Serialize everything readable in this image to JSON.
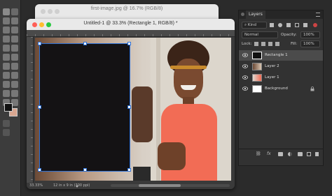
{
  "back_window": {
    "title": "first-image.jpg @ 16.7% (RGB/8)"
  },
  "document": {
    "title": "Untitled-1 @ 33.3% (Rectangle 1, RGB/8) *",
    "zoom": "33.33%",
    "doc_size": "12 in x 9 in (300 ppi)"
  },
  "layers_panel": {
    "tab_label": "Layers",
    "kind_label": "Kind",
    "blend_mode": "Normal",
    "opacity_label": "Opacity:",
    "opacity_value": "100%",
    "lock_label": "Lock:",
    "fill_label": "Fill:",
    "fill_value": "100%",
    "layers": [
      {
        "name": "Rectangle 1",
        "selected": true,
        "visible": true
      },
      {
        "name": "Layer 2",
        "selected": false,
        "visible": true
      },
      {
        "name": "Layer 1",
        "selected": false,
        "visible": true
      },
      {
        "name": "Background",
        "selected": false,
        "visible": true,
        "locked": true
      }
    ],
    "footer_icons": [
      "link-icon",
      "fx-icon",
      "mask-icon",
      "adjustment-icon",
      "folder-icon",
      "new-layer-icon",
      "trash-icon"
    ]
  },
  "colors": {
    "foreground": "#101010",
    "background": "#d9a791",
    "selection": "#2a6fd6"
  }
}
